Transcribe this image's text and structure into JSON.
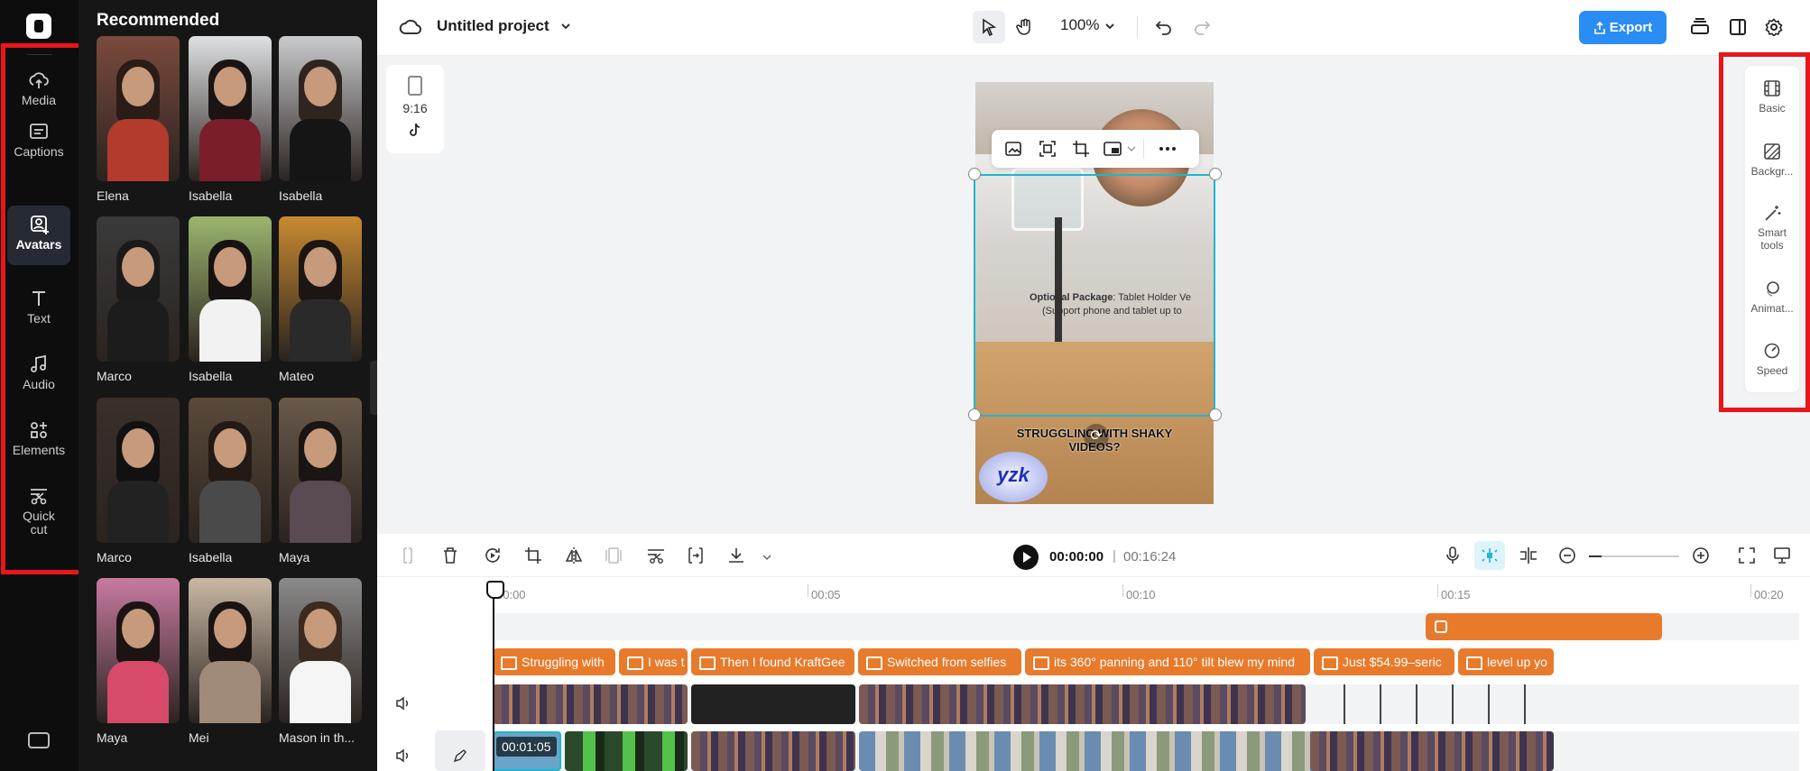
{
  "rail": {
    "items": [
      {
        "label": "Media",
        "icon": "cloud-upload-icon"
      },
      {
        "label": "Captions",
        "icon": "captions-icon"
      },
      {
        "label": "Avatars",
        "icon": "avatar-icon"
      },
      {
        "label": "Text",
        "icon": "text-icon"
      },
      {
        "label": "Audio",
        "icon": "music-note-icon"
      },
      {
        "label": "Elements",
        "icon": "elements-icon"
      },
      {
        "label": "Quick cut",
        "icon": "scissors-icon"
      }
    ],
    "active": "Avatars"
  },
  "panel": {
    "heading": "Recommended",
    "avatars": [
      {
        "name": "Elena",
        "hair": "#2a1c16",
        "top": "#b23b2c"
      },
      {
        "name": "Isabella",
        "hair": "#1a1414",
        "top": "#7a1e2a"
      },
      {
        "name": "Isabella",
        "hair": "#2e2420",
        "top": "#151515"
      },
      {
        "name": "Marco",
        "hair": "#1a1a1a",
        "top": "#1c1c1c"
      },
      {
        "name": "Isabella",
        "hair": "#161212",
        "top": "#f2f2f2"
      },
      {
        "name": "Mateo",
        "hair": "#1b1613",
        "top": "#2a2a2a"
      },
      {
        "name": "Marco",
        "hair": "#111111",
        "top": "#222222"
      },
      {
        "name": "Isabella",
        "hair": "#241a15",
        "top": "#4a4a4a"
      },
      {
        "name": "Maya",
        "hair": "#1a1412",
        "top": "#5a4a52"
      },
      {
        "name": "Maya",
        "hair": "#1c1412",
        "top": "#d84a6a"
      },
      {
        "name": "Mei",
        "hair": "#1a1412",
        "top": "#a08a78"
      },
      {
        "name": "Mason in th...",
        "hair": "#3a2a20",
        "top": "#f5f5f5"
      }
    ]
  },
  "topbar": {
    "project_title": "Untitled project",
    "zoom": "100%",
    "export_label": "Export"
  },
  "canvas": {
    "aspect_ratio": "9:16",
    "overlay_line1_bold": "Optional Package",
    "overlay_line1_rest": ": Tablet Holder Ve",
    "overlay_line2": "(Support phone and tablet up to",
    "headline": "STRUGGLING WITH SHAKY VIDEOS?",
    "brand": "yzk"
  },
  "props": [
    {
      "label": "Basic",
      "icon": "film-icon"
    },
    {
      "label": "Backgr...",
      "icon": "background-icon"
    },
    {
      "label": "Smart tools",
      "icon": "magic-wand-icon"
    },
    {
      "label": "Animat...",
      "icon": "animation-icon"
    },
    {
      "label": "Speed",
      "icon": "speedometer-icon"
    }
  ],
  "timeline": {
    "current_time": "00:00:00",
    "separator": "|",
    "total_time": "00:16:24",
    "ruler": [
      "00:00",
      "00:05",
      "00:10",
      "00:15",
      "00:20"
    ],
    "captions": [
      "Struggling with",
      "I was t",
      "Then I found KraftGee",
      "Switched from selfies",
      "its 360° panning and 110° tilt blew my mind",
      "Just $54.99–seric",
      "level up yo"
    ],
    "clip_timestamp": "00:01:05"
  },
  "colors": {
    "accent": "#2a8cf4",
    "caption_clip": "#e87a2c",
    "selection": "#1fb5cf",
    "highlight_box": "#e8151a"
  }
}
